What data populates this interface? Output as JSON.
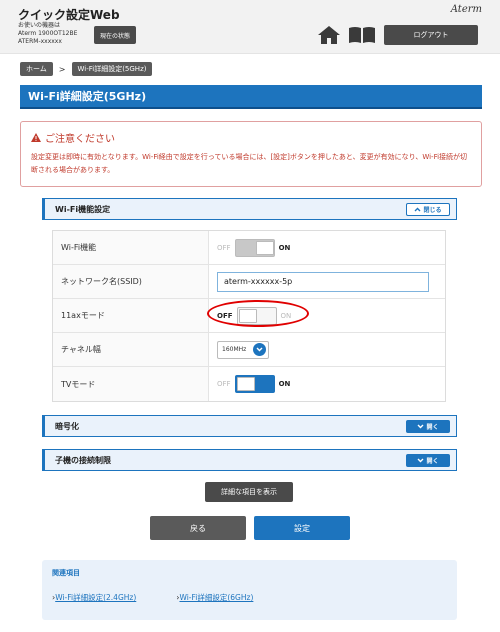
{
  "header": {
    "app_title": "クイック設定Web",
    "device_label": "お使いの機器は",
    "device_model": "Aterm 1900OT12BE",
    "device_id": "ATERM-xxxxxx",
    "status_button": "現在の状態",
    "brand": "Aterm",
    "logout_button": "ログアウト"
  },
  "breadcrumb": {
    "home": "ホーム",
    "separator": ">",
    "current": "Wi-Fi詳細設定(5GHz)"
  },
  "page_title": "Wi-Fi詳細設定(5GHz)",
  "caution": {
    "title": "ご注意ください",
    "text": "設定変更は即時に有効となります。Wi-Fi経由で設定を行っている場合には、[設定]ボタンを押したあと、変更が有効になり、Wi-Fi接続が切断される場合があります。"
  },
  "sections": {
    "wifi_function": {
      "title": "Wi-Fi機能設定",
      "button": "閉じる"
    },
    "encryption": {
      "title": "暗号化",
      "button": "開く"
    },
    "connection_limit": {
      "title": "子機の接続制限",
      "button": "開く"
    }
  },
  "settings": {
    "wifi_function": {
      "label": "Wi-Fi機能",
      "off": "OFF",
      "on": "ON",
      "state": "on"
    },
    "ssid": {
      "label": "ネットワーク名(SSID)",
      "value": "aterm-xxxxxx-5p"
    },
    "ax_mode": {
      "label": "11axモード",
      "off": "OFF",
      "on": "ON",
      "state": "off"
    },
    "channel_width": {
      "label": "チャネル幅",
      "value": "160MHz"
    },
    "tv_mode": {
      "label": "TVモード",
      "off": "OFF",
      "on": "ON",
      "state": "on"
    }
  },
  "buttons": {
    "show_details": "詳細な項目を表示",
    "back": "戻る",
    "apply": "設定"
  },
  "related": {
    "title": "関連項目",
    "links": [
      "Wi-Fi詳細設定(2.4GHz)",
      "Wi-Fi詳細設定(6GHz)"
    ]
  },
  "colors": {
    "primary_blue": "#1d74be",
    "caution_red": "#c0392b",
    "highlight_red": "#e00000"
  }
}
